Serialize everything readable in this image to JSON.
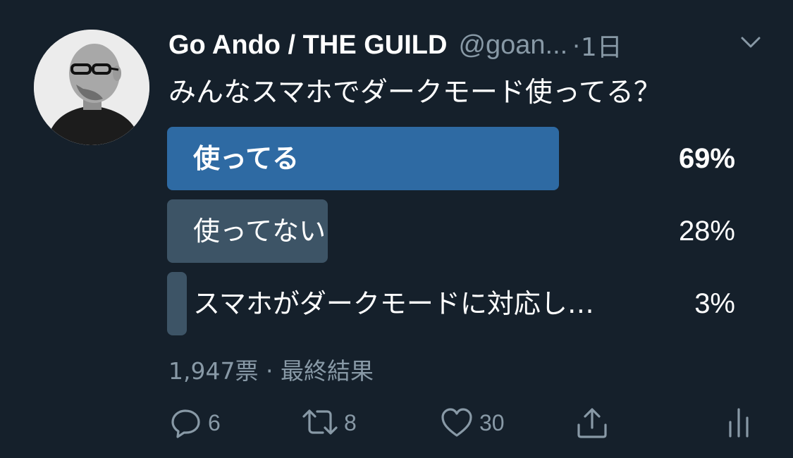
{
  "tweet": {
    "display_name": "Go Ando / THE GUILD",
    "handle": "@goan...",
    "separator": "·",
    "time": "1日",
    "text": "みんなスマホでダークモード使ってる？"
  },
  "poll": {
    "options": [
      {
        "label": "使ってる",
        "percent_text": "69%",
        "percent": 69,
        "winner": true,
        "color": "#2e6aa3"
      },
      {
        "label": "使ってない",
        "percent_text": "28%",
        "percent": 28,
        "winner": false,
        "color": "#3d5466"
      },
      {
        "label": "スマホがダークモードに対応し…",
        "percent_text": "3%",
        "percent": 3,
        "winner": false,
        "color": "#3d5466"
      }
    ],
    "meta": "1,947票 · 最終結果"
  },
  "actions": {
    "reply_count": "6",
    "retweet_count": "8",
    "like_count": "30"
  },
  "icons": {
    "caret": "chevron-down-icon",
    "reply": "reply-icon",
    "retweet": "retweet-icon",
    "like": "heart-icon",
    "share": "share-icon",
    "analytics": "analytics-icon"
  },
  "colors": {
    "background": "#15202b",
    "muted_text": "#8899a6",
    "poll_winner": "#2e6aa3",
    "poll_other": "#3d5466"
  }
}
